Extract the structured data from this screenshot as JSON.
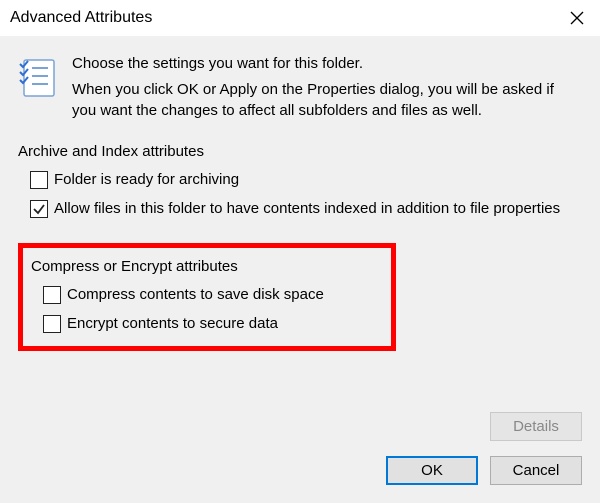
{
  "title": "Advanced Attributes",
  "intro": {
    "lead": "Choose the settings you want for this folder.",
    "body": "When you click OK or Apply on the Properties dialog, you will be asked if you want the changes to affect all subfolders and files as well."
  },
  "section_archive": {
    "label": "Archive and Index attributes",
    "cb_ready": {
      "label": "Folder is ready for archiving",
      "checked": false
    },
    "cb_index": {
      "label": "Allow files in this folder to have contents indexed in addition to file properties",
      "checked": true
    }
  },
  "section_compress": {
    "label": "Compress or Encrypt attributes",
    "cb_compress": {
      "label": "Compress contents to save disk space",
      "checked": false
    },
    "cb_encrypt": {
      "label": "Encrypt contents to secure data",
      "checked": false
    }
  },
  "buttons": {
    "details": "Details",
    "ok": "OK",
    "cancel": "Cancel"
  }
}
